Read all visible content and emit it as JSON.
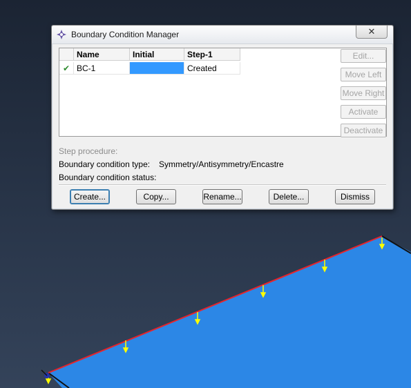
{
  "dialog": {
    "title": "Boundary Condition Manager",
    "close_label": "✕"
  },
  "table": {
    "columns": [
      "",
      "Name",
      "Initial",
      "Step-1"
    ],
    "rows": [
      {
        "status": "✔",
        "name": "BC-1",
        "initial": "",
        "step1": "Created"
      }
    ]
  },
  "side_buttons": {
    "edit": "Edit...",
    "move_left": "Move Left",
    "move_right": "Move Right",
    "activate": "Activate",
    "deactivate": "Deactivate"
  },
  "info": {
    "step_procedure_label": "Step procedure:",
    "bc_type_label": "Boundary condition type:",
    "bc_type_value": "Symmetry/Antisymmetry/Encastre",
    "bc_status_label": "Boundary condition status:"
  },
  "buttons": {
    "create": "Create...",
    "copy": "Copy...",
    "rename": "Rename...",
    "delete": "Delete...",
    "dismiss": "Dismiss"
  },
  "colors": {
    "viewport_top": "#1b2433",
    "viewport_bottom": "#34435a",
    "part_fill": "#2c87e6",
    "edge": "#e8232a",
    "bc_marker": "#ffff00",
    "selection": "#3399ff"
  }
}
